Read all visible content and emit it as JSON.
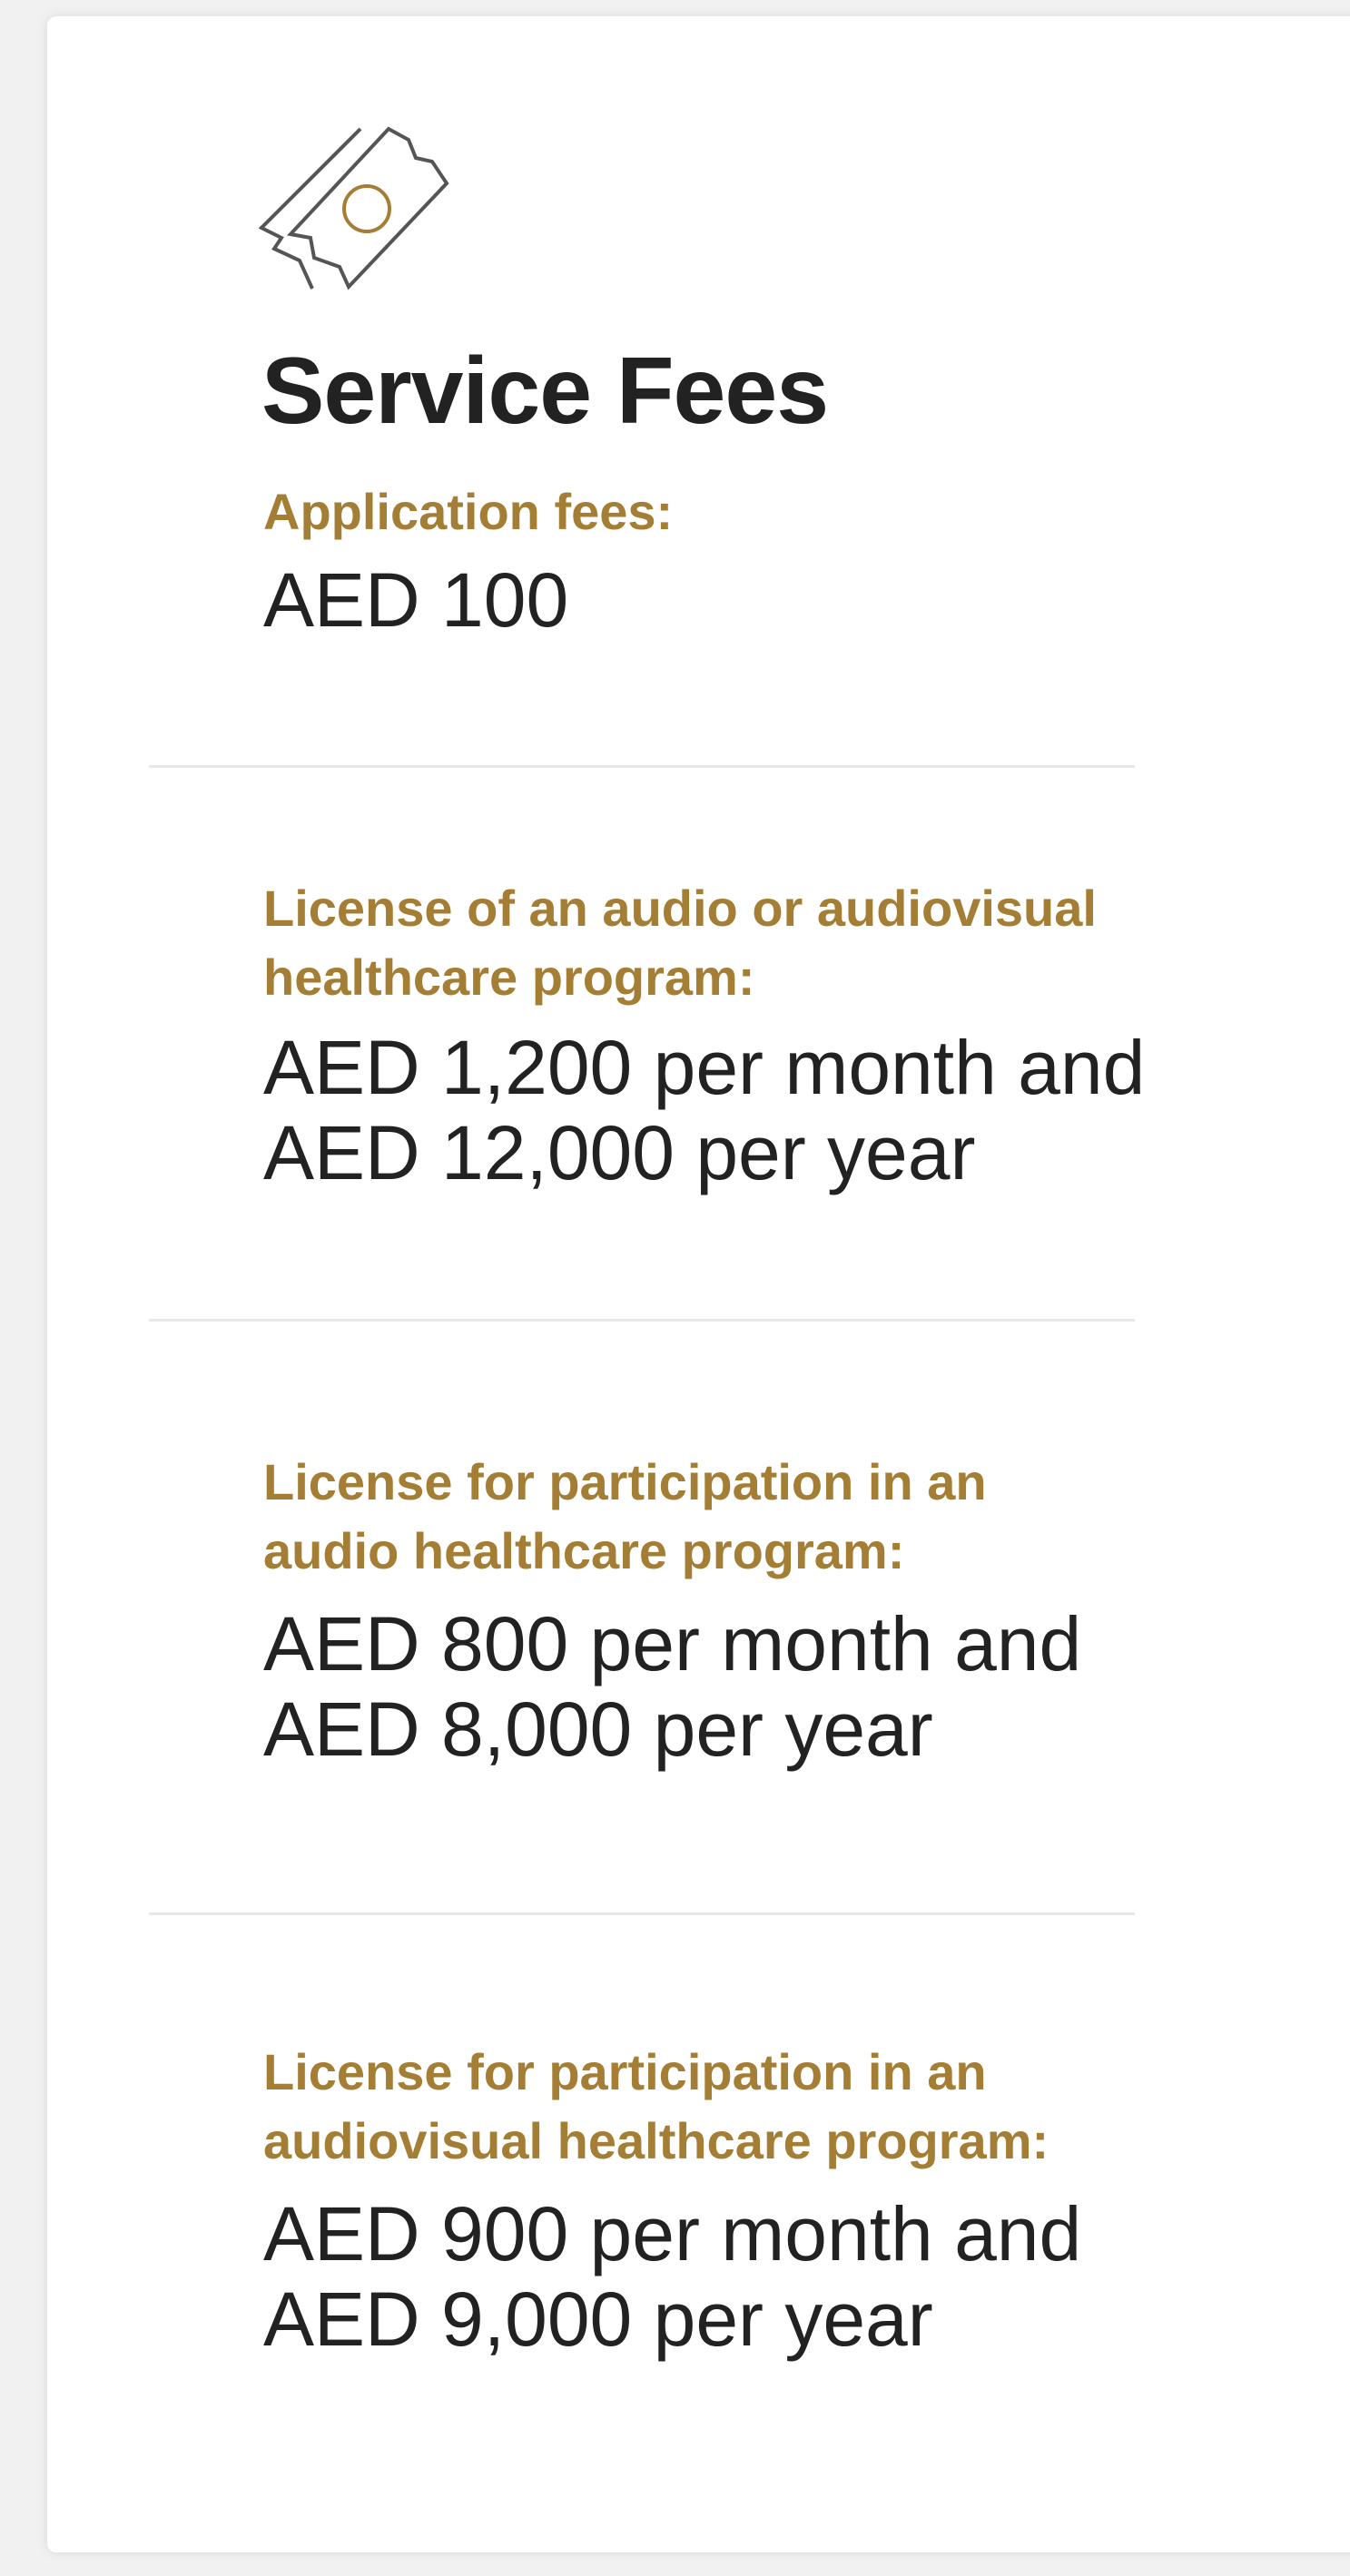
{
  "colors": {
    "accent": "#a47e34",
    "text": "#222222",
    "divider": "#e7e7e7",
    "background": "#ffffff"
  },
  "icon": "ticket-icon",
  "title": "Service Fees",
  "fees": [
    {
      "label_lines": [
        "Application fees:"
      ],
      "value_lines": [
        "AED 100"
      ]
    },
    {
      "label_lines": [
        "License of an audio or audiovisual",
        "healthcare program:"
      ],
      "value_lines": [
        "AED 1,200 per month and",
        "AED 12,000 per year"
      ]
    },
    {
      "label_lines": [
        "License for participation in an",
        "audio healthcare program:"
      ],
      "value_lines": [
        "AED 800 per month and",
        "AED 8,000 per year"
      ]
    },
    {
      "label_lines": [
        "License for participation in an",
        "audiovisual healthcare program:"
      ],
      "value_lines": [
        "AED 900 per month and",
        "AED 9,000 per year"
      ]
    }
  ]
}
